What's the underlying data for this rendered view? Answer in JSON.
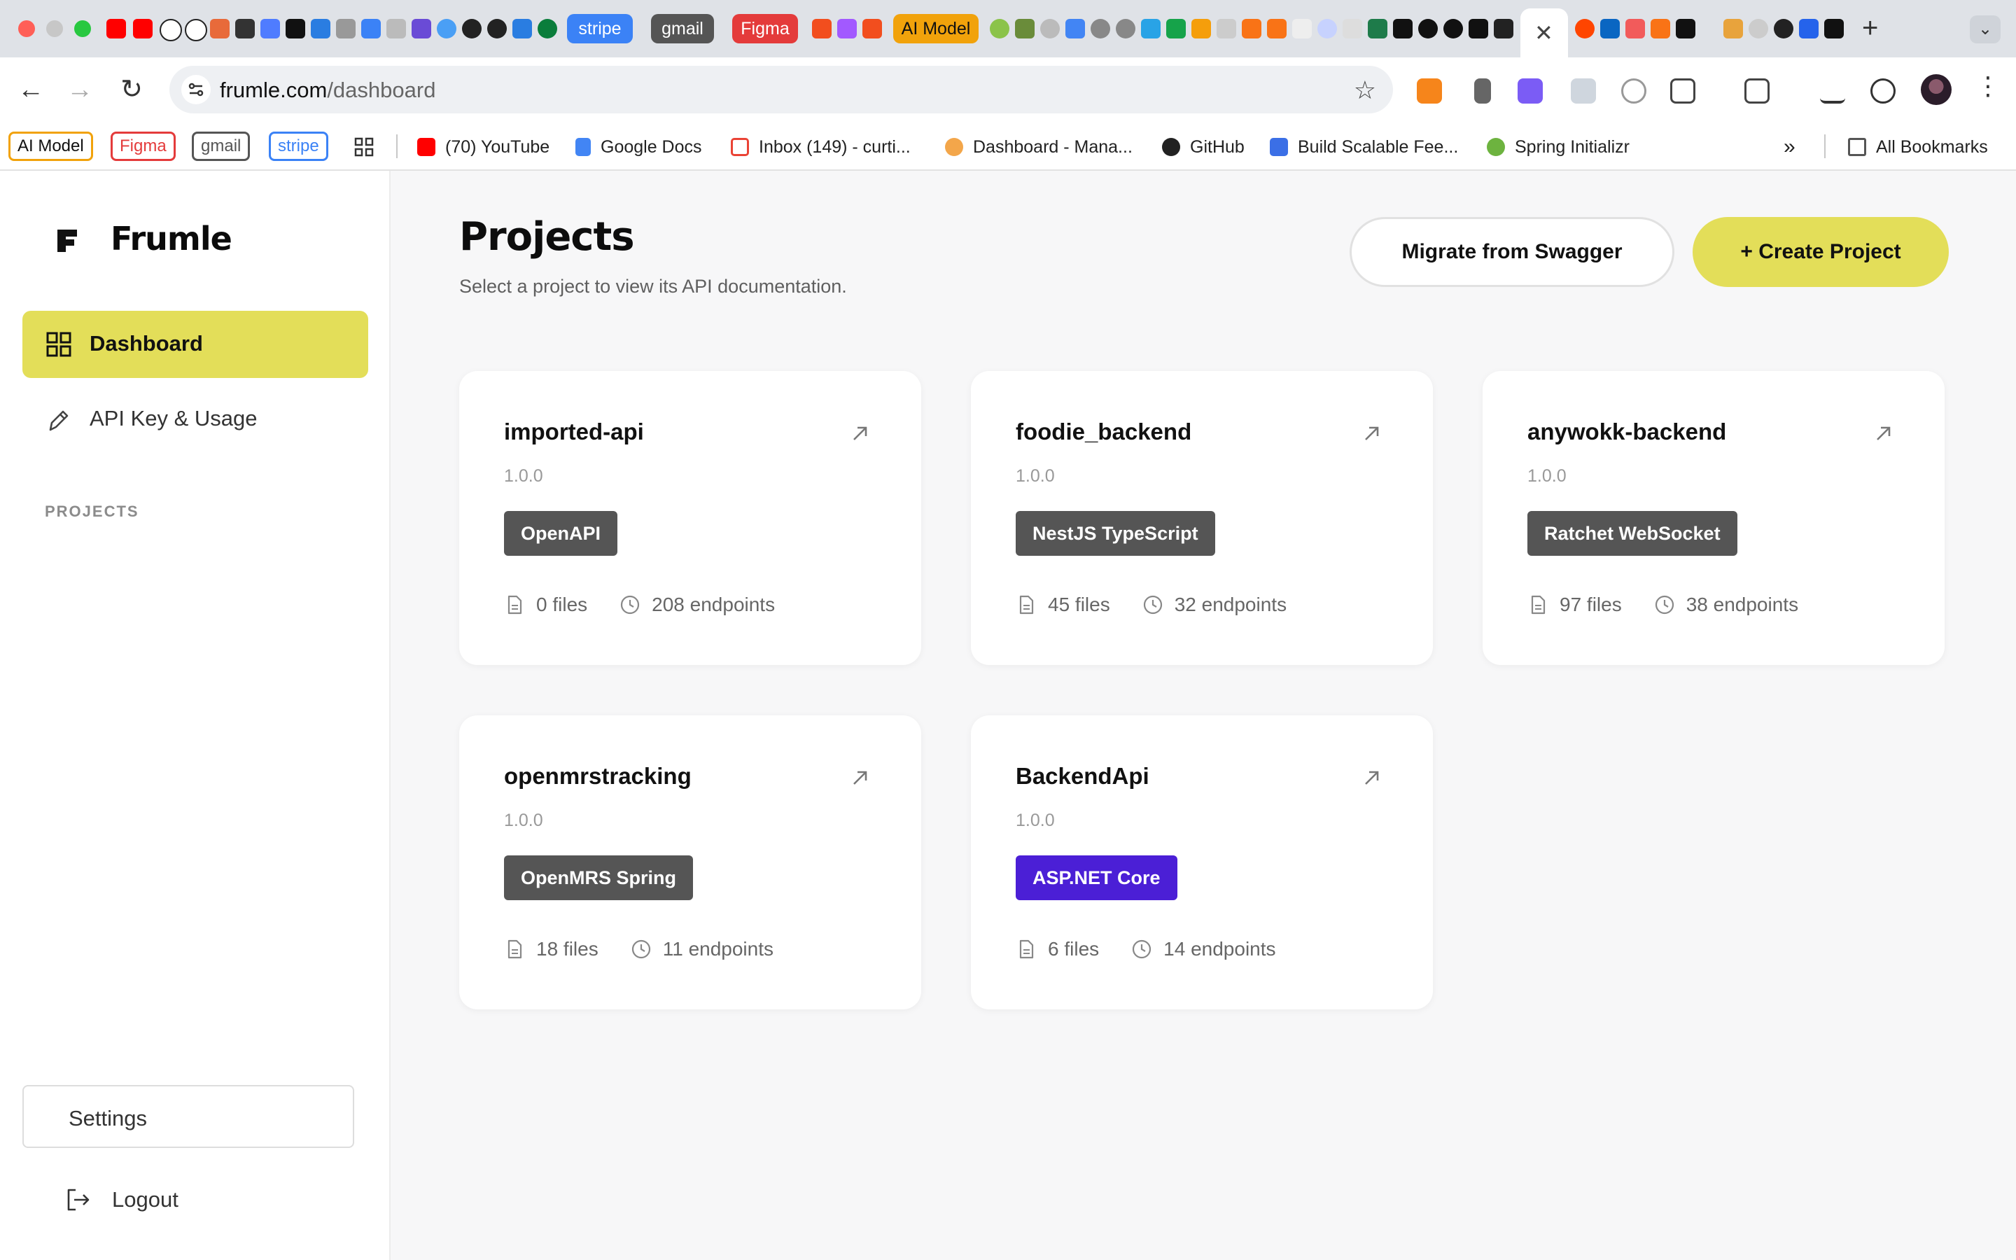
{
  "browser": {
    "tabs": {
      "stripe": "stripe",
      "gmail": "gmail",
      "figma": "Figma",
      "ai_model": "AI Model"
    },
    "url_host": "frumle.com",
    "url_path": "/dashboard",
    "bookmarks": {
      "pill_ai_model": "AI Model",
      "pill_figma": "Figma",
      "pill_gmail": "gmail",
      "pill_stripe": "stripe",
      "youtube": "(70) YouTube",
      "docs": "Google Docs",
      "inbox": "Inbox (149) - curti...",
      "dashboard": "Dashboard - Mana...",
      "github": "GitHub",
      "build": "Build Scalable Fee...",
      "spring": "Spring Initializr",
      "all": "All Bookmarks"
    }
  },
  "sidebar": {
    "brand": "Frumle",
    "nav": {
      "dashboard": "Dashboard",
      "api_key": "API Key & Usage"
    },
    "projects_heading": "PROJECTS",
    "settings": "Settings",
    "logout": "Logout"
  },
  "header": {
    "title": "Projects",
    "subtitle": "Select a project to view its API documentation.",
    "migrate_button": "Migrate from Swagger",
    "create_button": "+ Create Project"
  },
  "projects": [
    {
      "name": "imported-api",
      "version": "1.0.0",
      "badge": "OpenAPI",
      "badge_color": "#555555",
      "files": "0 files",
      "endpoints": "208 endpoints"
    },
    {
      "name": "foodie_backend",
      "version": "1.0.0",
      "badge": "NestJS TypeScript",
      "badge_color": "#555555",
      "files": "45 files",
      "endpoints": "32 endpoints"
    },
    {
      "name": "anywokk-backend",
      "version": "1.0.0",
      "badge": "Ratchet WebSocket",
      "badge_color": "#555555",
      "files": "97 files",
      "endpoints": "38 endpoints"
    },
    {
      "name": "openmrstracking",
      "version": "1.0.0",
      "badge": "OpenMRS Spring",
      "badge_color": "#555555",
      "files": "18 files",
      "endpoints": "11 endpoints"
    },
    {
      "name": "BackendApi",
      "version": "1.0.0",
      "badge": "ASP.NET Core",
      "badge_color": "#4b1fd6",
      "files": "6 files",
      "endpoints": "14 endpoints"
    }
  ],
  "colors": {
    "accent": "#e3de59",
    "muted_badge": "#555555",
    "aspnet_badge": "#4b1fd6"
  }
}
